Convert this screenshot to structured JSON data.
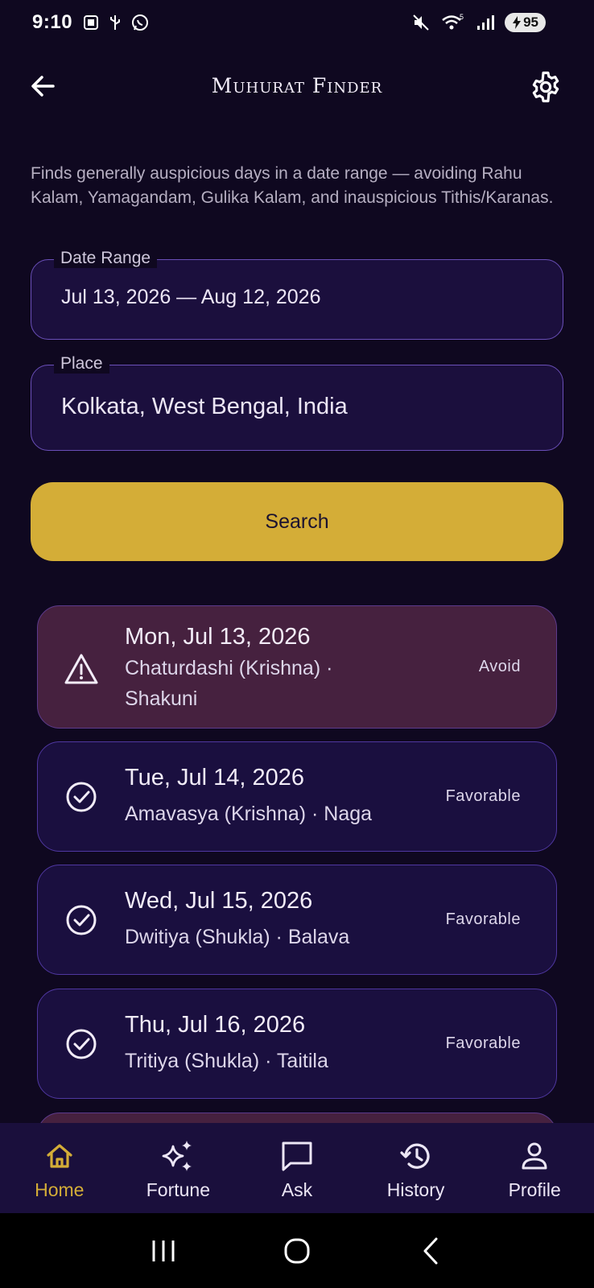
{
  "status_bar": {
    "time": "9:10",
    "battery": "95",
    "icons": [
      "screenshot-icon",
      "usb-icon",
      "whatsapp-icon",
      "mute-icon",
      "wifi-icon",
      "signal-icon",
      "battery-icon"
    ]
  },
  "app_bar": {
    "title": "Muhurat Finder",
    "back_icon": "arrow-left-icon",
    "settings_icon": "gear-icon"
  },
  "description": "Finds generally auspicious days in a date range — avoiding Rahu Kalam, Yamagandam, Gulika Kalam, and inauspicious Tithis/Karanas.",
  "date_range": {
    "label": "Date Range",
    "value": "Jul 13, 2026 — Aug 12, 2026"
  },
  "place": {
    "label": "Place",
    "value": "Kolkata, West Bengal, India"
  },
  "search_button": "Search",
  "results": [
    {
      "date": "Mon, Jul 13, 2026",
      "detail": "Chaturdashi (Krishna) · Shakuni",
      "status": "Avoid",
      "icon": "warning-icon"
    },
    {
      "date": "Tue, Jul 14, 2026",
      "detail": "Amavasya (Krishna) · Naga",
      "status": "Favorable",
      "icon": "check-circle-icon"
    },
    {
      "date": "Wed, Jul 15, 2026",
      "detail": "Dwitiya (Shukla) · Balava",
      "status": "Favorable",
      "icon": "check-circle-icon"
    },
    {
      "date": "Thu, Jul 16, 2026",
      "detail": "Tritiya (Shukla) · Taitila",
      "status": "Favorable",
      "icon": "check-circle-icon"
    }
  ],
  "bottom_nav": [
    {
      "label": "Home",
      "icon": "home-icon",
      "active": true
    },
    {
      "label": "Fortune",
      "icon": "sparkles-icon",
      "active": false
    },
    {
      "label": "Ask",
      "icon": "chat-icon",
      "active": false
    },
    {
      "label": "History",
      "icon": "history-icon",
      "active": false
    },
    {
      "label": "Profile",
      "icon": "profile-icon",
      "active": false
    }
  ],
  "colors": {
    "background": "#0f0820",
    "accent": "#d4ad37",
    "card": "#1a0f3f",
    "card_avoid": "#46213f",
    "border": "#6a4fb8"
  }
}
